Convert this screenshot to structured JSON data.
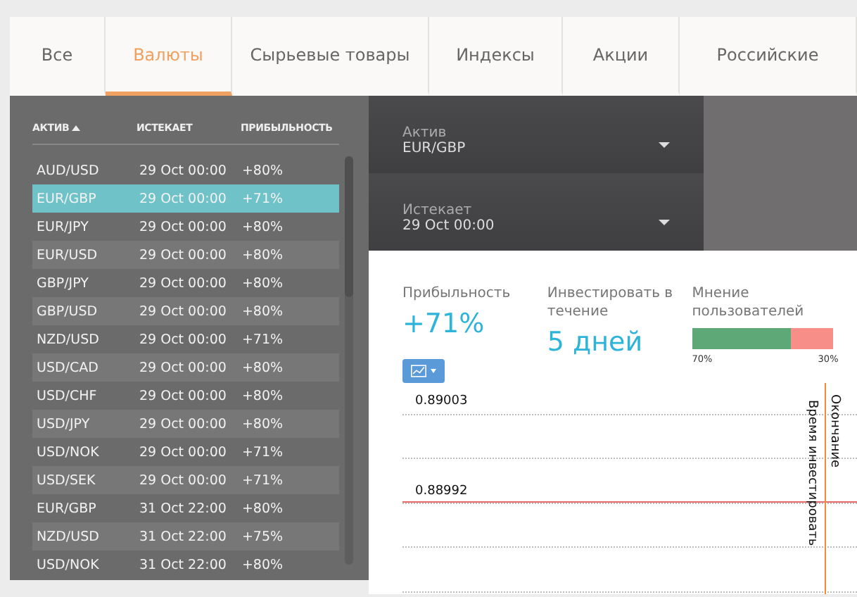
{
  "tabs": [
    {
      "label": "Все",
      "selected": false
    },
    {
      "label": "Валюты",
      "selected": true
    },
    {
      "label": "Сырьевые товары",
      "selected": false
    },
    {
      "label": "Индексы",
      "selected": false
    },
    {
      "label": "Акции",
      "selected": false
    },
    {
      "label": "Российские",
      "selected": false
    }
  ],
  "assets_table": {
    "columns": [
      {
        "label": "АКТИВ",
        "sorted": true
      },
      {
        "label": "ИСТЕКАЕТ",
        "sorted": false
      },
      {
        "label": "ПРИБЫЛЬНОСТЬ",
        "sorted": false
      }
    ],
    "rows": [
      {
        "asset": "AUD/USD",
        "expires": "29 Oct 00:00",
        "payout": "+80%",
        "selected": false
      },
      {
        "asset": "EUR/GBP",
        "expires": "29 Oct 00:00",
        "payout": "+71%",
        "selected": true
      },
      {
        "asset": "EUR/JPY",
        "expires": "29 Oct 00:00",
        "payout": "+80%",
        "selected": false
      },
      {
        "asset": "EUR/USD",
        "expires": "29 Oct 00:00",
        "payout": "+80%",
        "selected": false
      },
      {
        "asset": "GBP/JPY",
        "expires": "29 Oct 00:00",
        "payout": "+80%",
        "selected": false
      },
      {
        "asset": "GBP/USD",
        "expires": "29 Oct 00:00",
        "payout": "+80%",
        "selected": false
      },
      {
        "asset": "NZD/USD",
        "expires": "29 Oct 00:00",
        "payout": "+71%",
        "selected": false
      },
      {
        "asset": "USD/CAD",
        "expires": "29 Oct 00:00",
        "payout": "+80%",
        "selected": false
      },
      {
        "asset": "USD/CHF",
        "expires": "29 Oct 00:00",
        "payout": "+80%",
        "selected": false
      },
      {
        "asset": "USD/JPY",
        "expires": "29 Oct 00:00",
        "payout": "+80%",
        "selected": false
      },
      {
        "asset": "USD/NOK",
        "expires": "29 Oct 00:00",
        "payout": "+71%",
        "selected": false
      },
      {
        "asset": "USD/SEK",
        "expires": "29 Oct 00:00",
        "payout": "+71%",
        "selected": false
      },
      {
        "asset": "EUR/GBP",
        "expires": "31 Oct 22:00",
        "payout": "+80%",
        "selected": false
      },
      {
        "asset": "NZD/USD",
        "expires": "31 Oct 22:00",
        "payout": "+75%",
        "selected": false
      },
      {
        "asset": "USD/NOK",
        "expires": "31 Oct 22:00",
        "payout": "+80%",
        "selected": false
      }
    ]
  },
  "dropdowns": [
    {
      "label": "Актив",
      "value": "EUR/GBP"
    },
    {
      "label": "Истекает",
      "value": "29 Oct 00:00"
    }
  ],
  "stats": {
    "payout_label": "Прибыльность",
    "payout_value": "+71%",
    "invest_label": "Инвестировать в течение",
    "invest_value": "5 дней",
    "sentiment_label": "Мнение пользователей",
    "sentiment": {
      "level": 0.7,
      "up_text": "70%",
      "down_text": "30%"
    }
  },
  "chart": {
    "price_labels": [
      "0.89003",
      "0.88992"
    ],
    "invest_time_label": "Время инвестировать",
    "expiry_label": "Окончание"
  }
}
